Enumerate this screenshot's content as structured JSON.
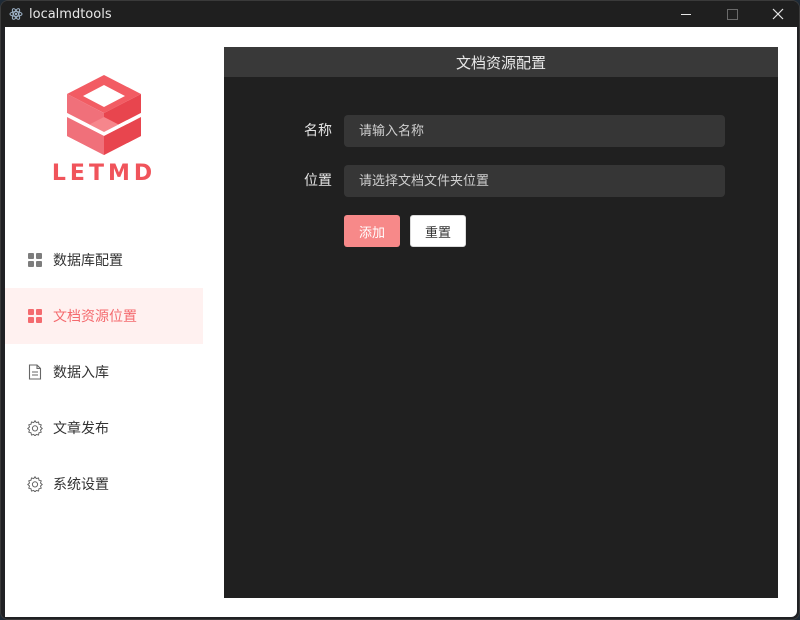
{
  "window": {
    "title": "localmdtools",
    "app_icon": "atom-icon",
    "controls": [
      "minimize-icon",
      "maximize-icon",
      "close-icon"
    ]
  },
  "brand": {
    "name": "LETMD",
    "logo_icon": "isometric-cube-logo",
    "color": "#f0545b"
  },
  "sidebar": {
    "items": [
      {
        "label": "数据库配置",
        "icon": "grid-icon",
        "active": false
      },
      {
        "label": "文档资源位置",
        "icon": "grid-icon",
        "active": true
      },
      {
        "label": "数据入库",
        "icon": "document-icon",
        "active": false
      },
      {
        "label": "文章发布",
        "icon": "gear-icon",
        "active": false
      },
      {
        "label": "系统设置",
        "icon": "gear-icon",
        "active": false
      }
    ]
  },
  "main": {
    "title": "文档资源配置",
    "form": {
      "name_label": "名称",
      "name_placeholder": "请输入名称",
      "location_label": "位置",
      "location_placeholder": "请选择文档文件夹位置"
    },
    "buttons": {
      "add_label": "添加",
      "reset_label": "重置"
    }
  },
  "colors": {
    "accent": "#f46a6e",
    "add_button": "#f78989",
    "active_nav_bg": "#fff1f0",
    "content_bg": "#202020",
    "header_bg": "#393939",
    "input_bg": "#363636"
  }
}
